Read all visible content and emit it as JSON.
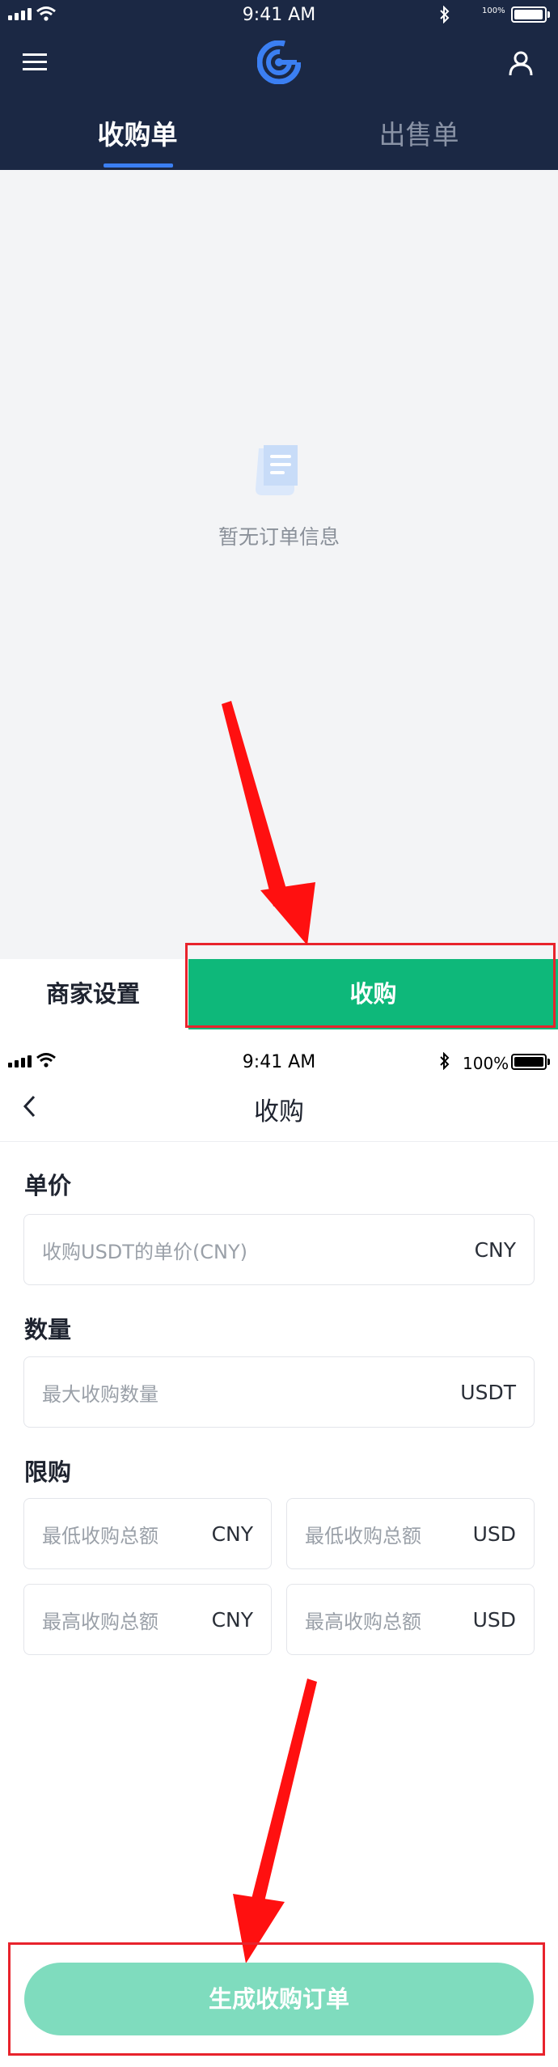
{
  "screen1": {
    "status": {
      "time": "9:41 AM",
      "battery": "100%"
    },
    "header": {
      "menu_icon": "menu-icon",
      "logo_icon": "logo-icon",
      "profile_icon": "user-icon"
    },
    "tabs": [
      {
        "label": "收购单",
        "active": true
      },
      {
        "label": "出售单",
        "active": false
      }
    ],
    "empty_state": {
      "icon": "document-icon",
      "text": "暂无订单信息"
    },
    "bottom": {
      "merchant_settings": "商家设置",
      "buy_button": "收购"
    },
    "colors": {
      "header_bg": "#1b2844",
      "accent": "#3b7ff2",
      "green": "#0eb87a",
      "content_bg": "#f3f4f6",
      "highlight": "#e8232c"
    }
  },
  "screen2": {
    "status": {
      "time": "9:41 AM",
      "battery": "100%"
    },
    "nav": {
      "back_icon": "chevron-left-icon",
      "title": "收购"
    },
    "price": {
      "label": "单价",
      "placeholder": "收购USDT的单价(CNY)",
      "unit": "CNY"
    },
    "quantity": {
      "label": "数量",
      "placeholder": "最大收购数量",
      "unit": "USDT"
    },
    "limit": {
      "label": "限购",
      "fields": [
        {
          "placeholder": "最低收购总额",
          "unit": "CNY"
        },
        {
          "placeholder": "最低收购总额",
          "unit": "USD"
        },
        {
          "placeholder": "最高收购总额",
          "unit": "CNY"
        },
        {
          "placeholder": "最高收购总额",
          "unit": "USD"
        }
      ]
    },
    "submit": {
      "label": "生成收购订单"
    },
    "colors": {
      "submit_bg": "#7fdcbe",
      "arrow": "#ff1010"
    }
  }
}
